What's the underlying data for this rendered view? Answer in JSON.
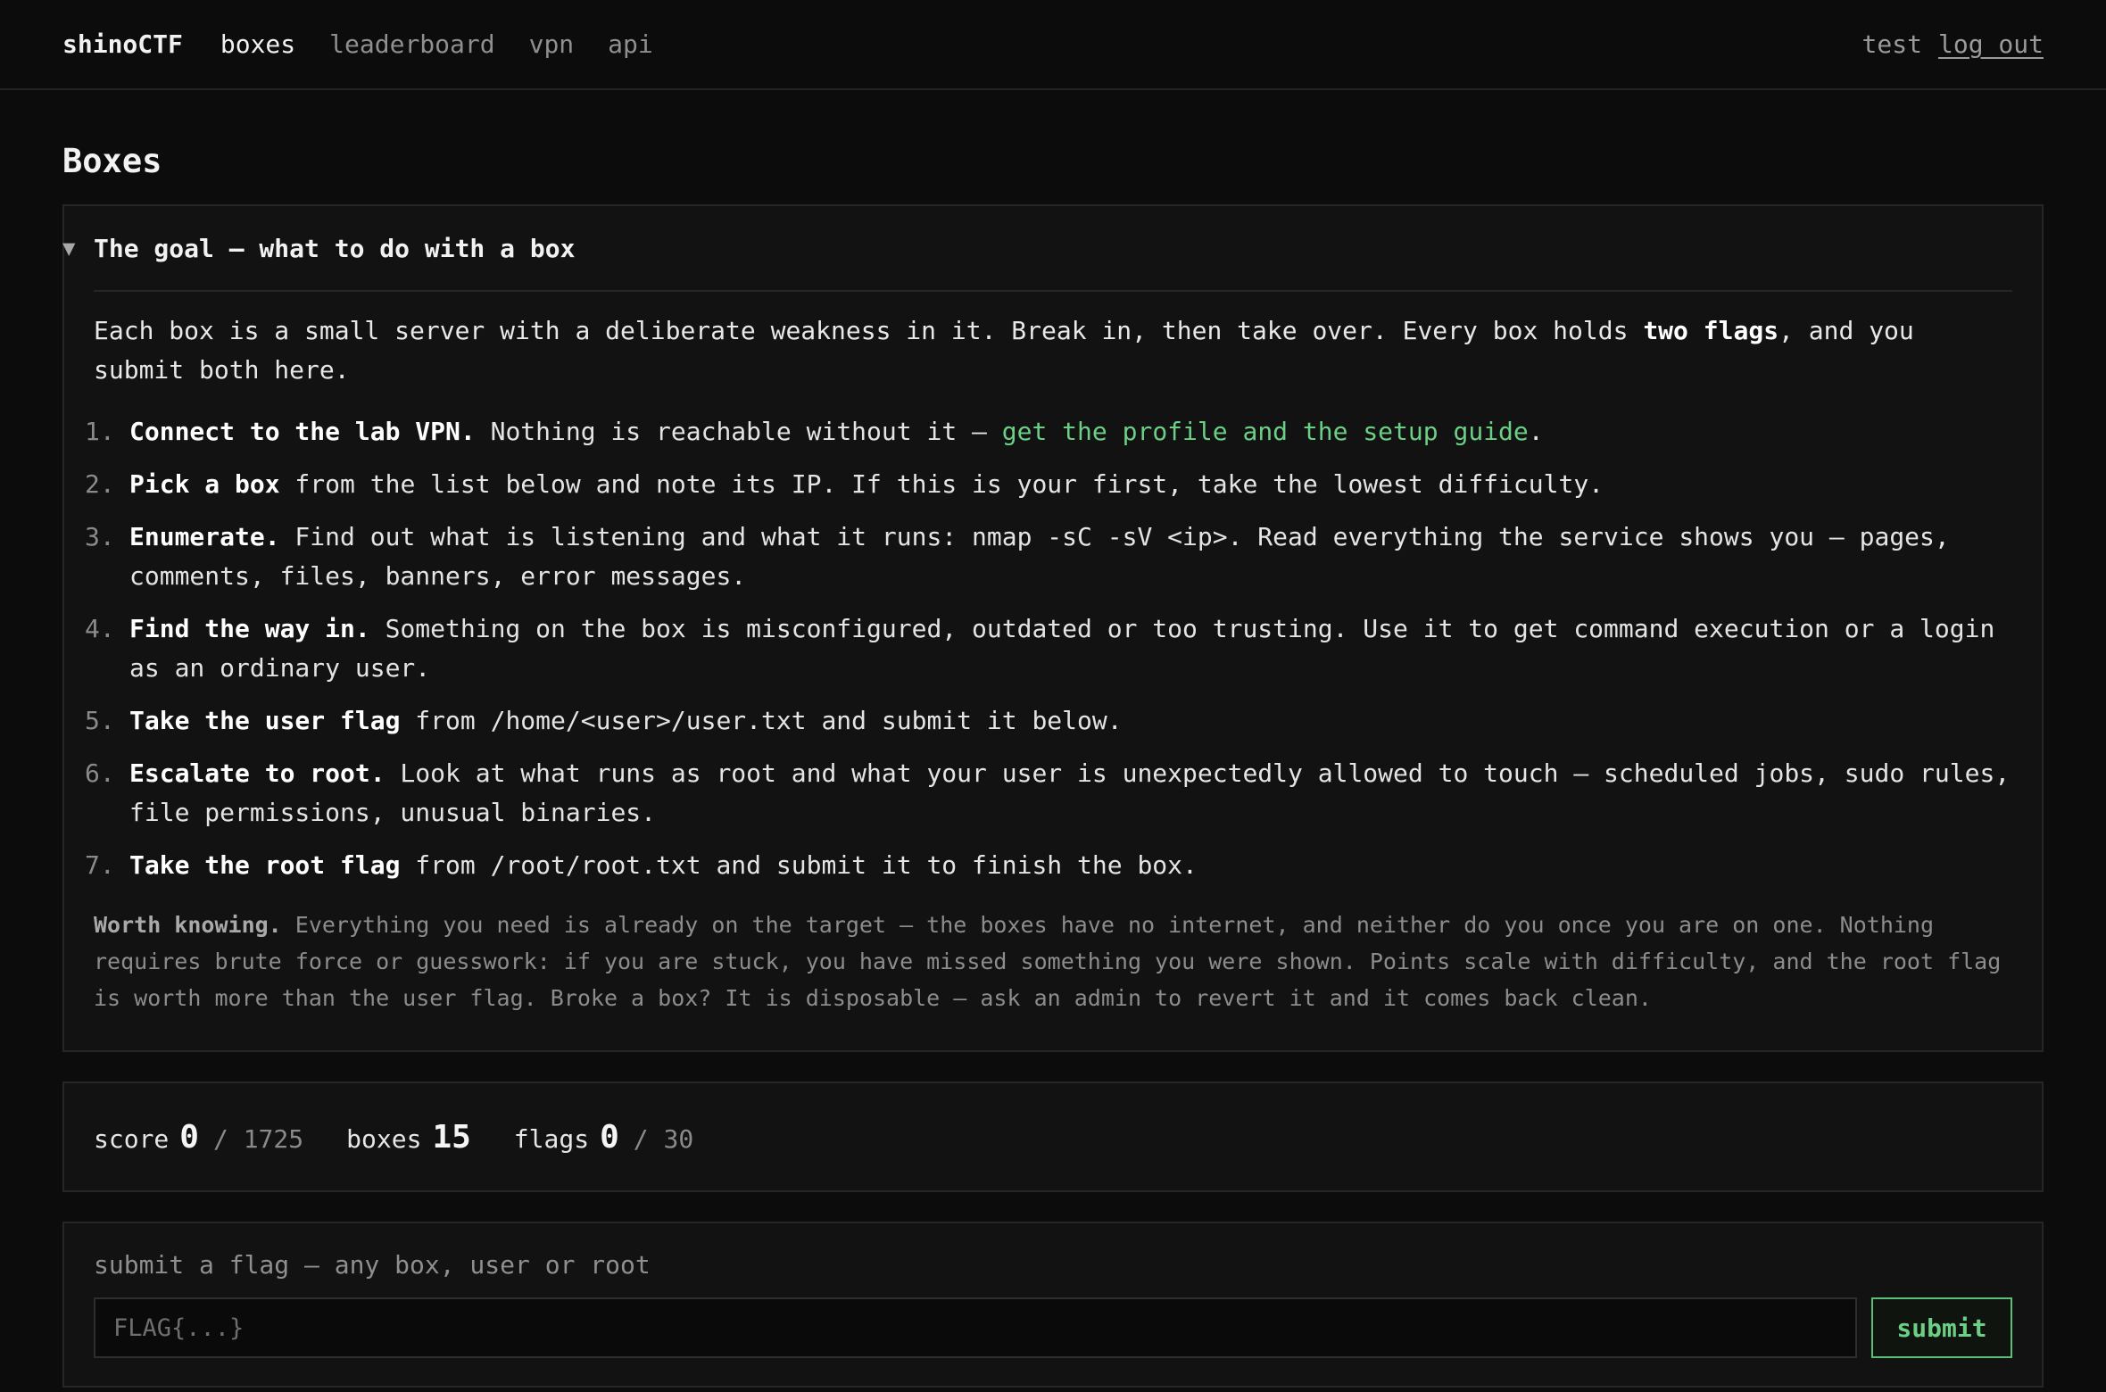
{
  "nav": {
    "brand": "shinoCTF",
    "links": [
      {
        "label": "boxes"
      },
      {
        "label": "leaderboard"
      },
      {
        "label": "vpn"
      },
      {
        "label": "api"
      }
    ],
    "username": "test",
    "logout_label": "log out"
  },
  "page": {
    "title": "Boxes"
  },
  "goal": {
    "summary": "The goal — what to do with a box",
    "intro_before": "Each box is a small server with a deliberate weakness in it. Break in, then take over. Every box holds ",
    "intro_bold": "two flags",
    "intro_after": ", and you submit both here.",
    "steps": [
      {
        "num": "1.",
        "bold": "Connect to the lab VPN.",
        "text": " Nothing is reachable without it — ",
        "link": "get the profile and the setup guide",
        "after": "."
      },
      {
        "num": "2.",
        "bold": "Pick a box",
        "text": " from the list below and note its IP. If this is your first, take the lowest difficulty."
      },
      {
        "num": "3.",
        "bold": "Enumerate.",
        "text": " Find out what is listening and what it runs: nmap -sC -sV <ip>. Read everything the service shows you — pages, comments, files, banners, error messages."
      },
      {
        "num": "4.",
        "bold": "Find the way in.",
        "text": " Something on the box is misconfigured, outdated or too trusting. Use it to get command execution or a login as an ordinary user."
      },
      {
        "num": "5.",
        "bold": "Take the user flag",
        "text": " from /home/<user>/user.txt and submit it below."
      },
      {
        "num": "6.",
        "bold": "Escalate to root.",
        "text": " Look at what runs as root and what your user is unexpectedly allowed to touch — scheduled jobs, sudo rules, file permissions, unusual binaries."
      },
      {
        "num": "7.",
        "bold": "Take the root flag",
        "text": " from /root/root.txt and submit it to finish the box."
      }
    ],
    "worth_bold": "Worth knowing.",
    "worth_text": " Everything you need is already on the target — the boxes have no internet, and neither do you once you are on one. Nothing requires brute force or guesswork: if you are stuck, you have missed something you were shown. Points scale with difficulty, and the root flag is worth more than the user flag. Broke a box? It is disposable — ask an admin to revert it and it comes back clean."
  },
  "stats": {
    "score_label": "score",
    "score_value": "0",
    "score_total": "/ 1725",
    "boxes_label": "boxes",
    "boxes_value": "15",
    "flags_label": "flags",
    "flags_value": "0",
    "flags_total": "/ 30"
  },
  "submit": {
    "label": "submit a flag — any box, user or root",
    "placeholder": "FLAG{...}",
    "value": "",
    "button_label": "submit"
  },
  "colors": {
    "background": "#0c0c0c",
    "panel": "#121212",
    "accent_green": "#6ccf86",
    "muted_text": "#8f8f8f"
  }
}
